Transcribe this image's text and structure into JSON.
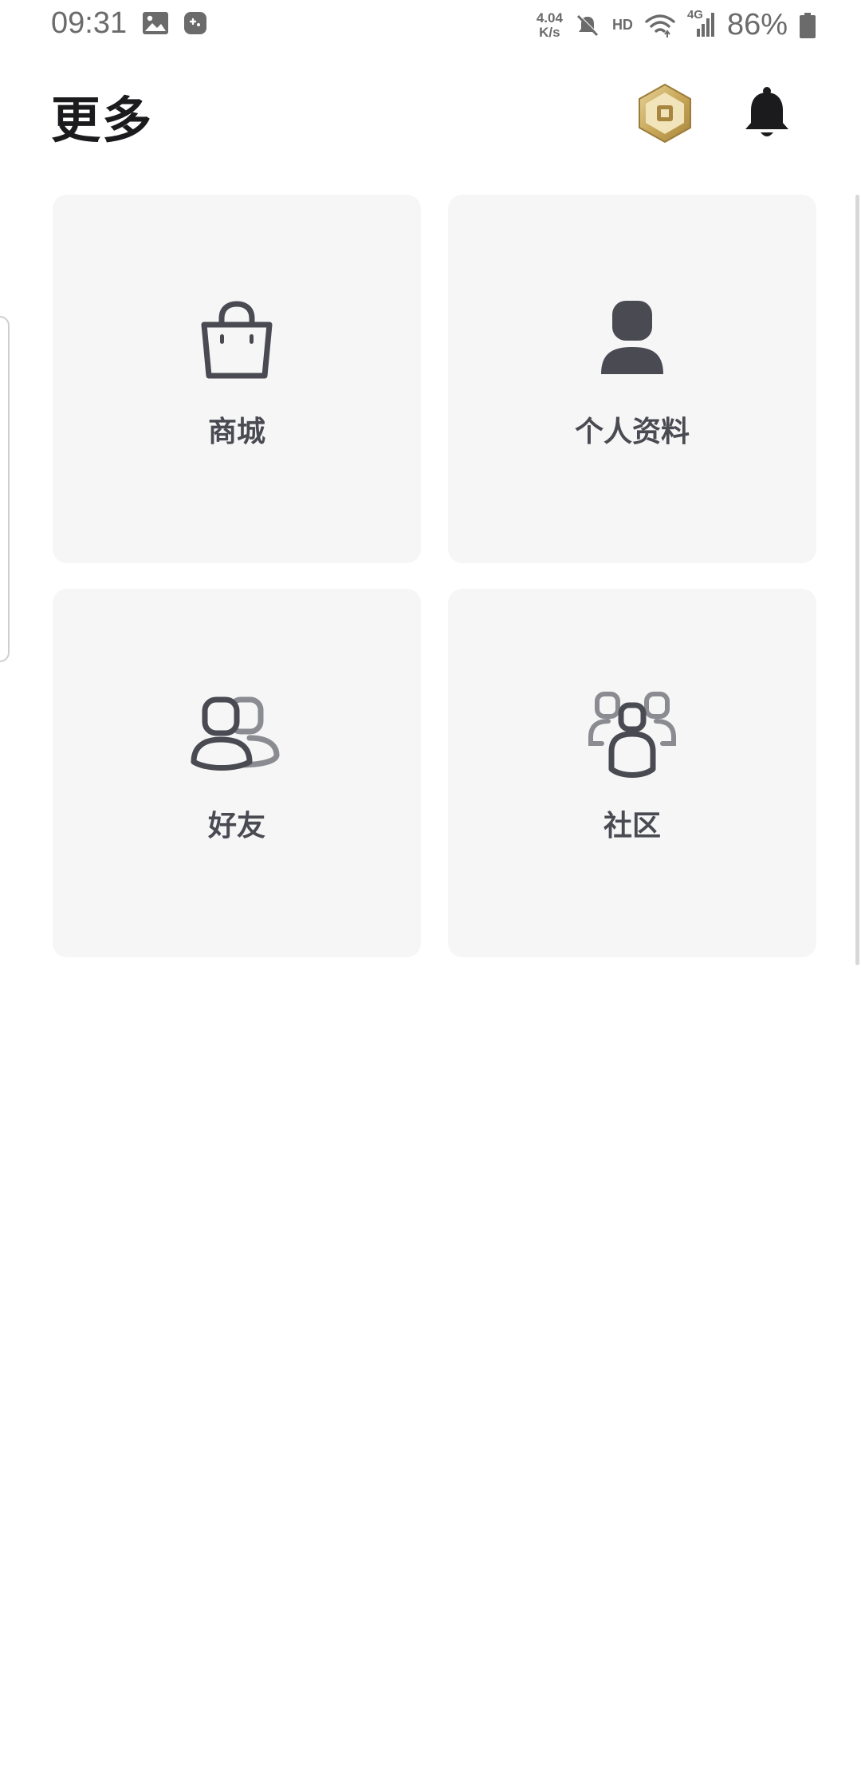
{
  "status_bar": {
    "time": "09:31",
    "net_speed_value": "4.04",
    "net_speed_unit": "K/s",
    "hd_label": "HD",
    "network_type": "4G",
    "battery": "86%"
  },
  "header": {
    "title": "更多"
  },
  "tiles": [
    {
      "label": "商城",
      "icon": "shopping-bag-icon"
    },
    {
      "label": "个人资料",
      "icon": "profile-icon"
    },
    {
      "label": "好友",
      "icon": "friends-icon"
    },
    {
      "label": "社区",
      "icon": "groups-icon"
    }
  ],
  "colors": {
    "tile_background": "#f6f6f7",
    "icon": "#4a4b52",
    "title": "#1b1b1d",
    "robux_gold": "#c9a85a"
  }
}
